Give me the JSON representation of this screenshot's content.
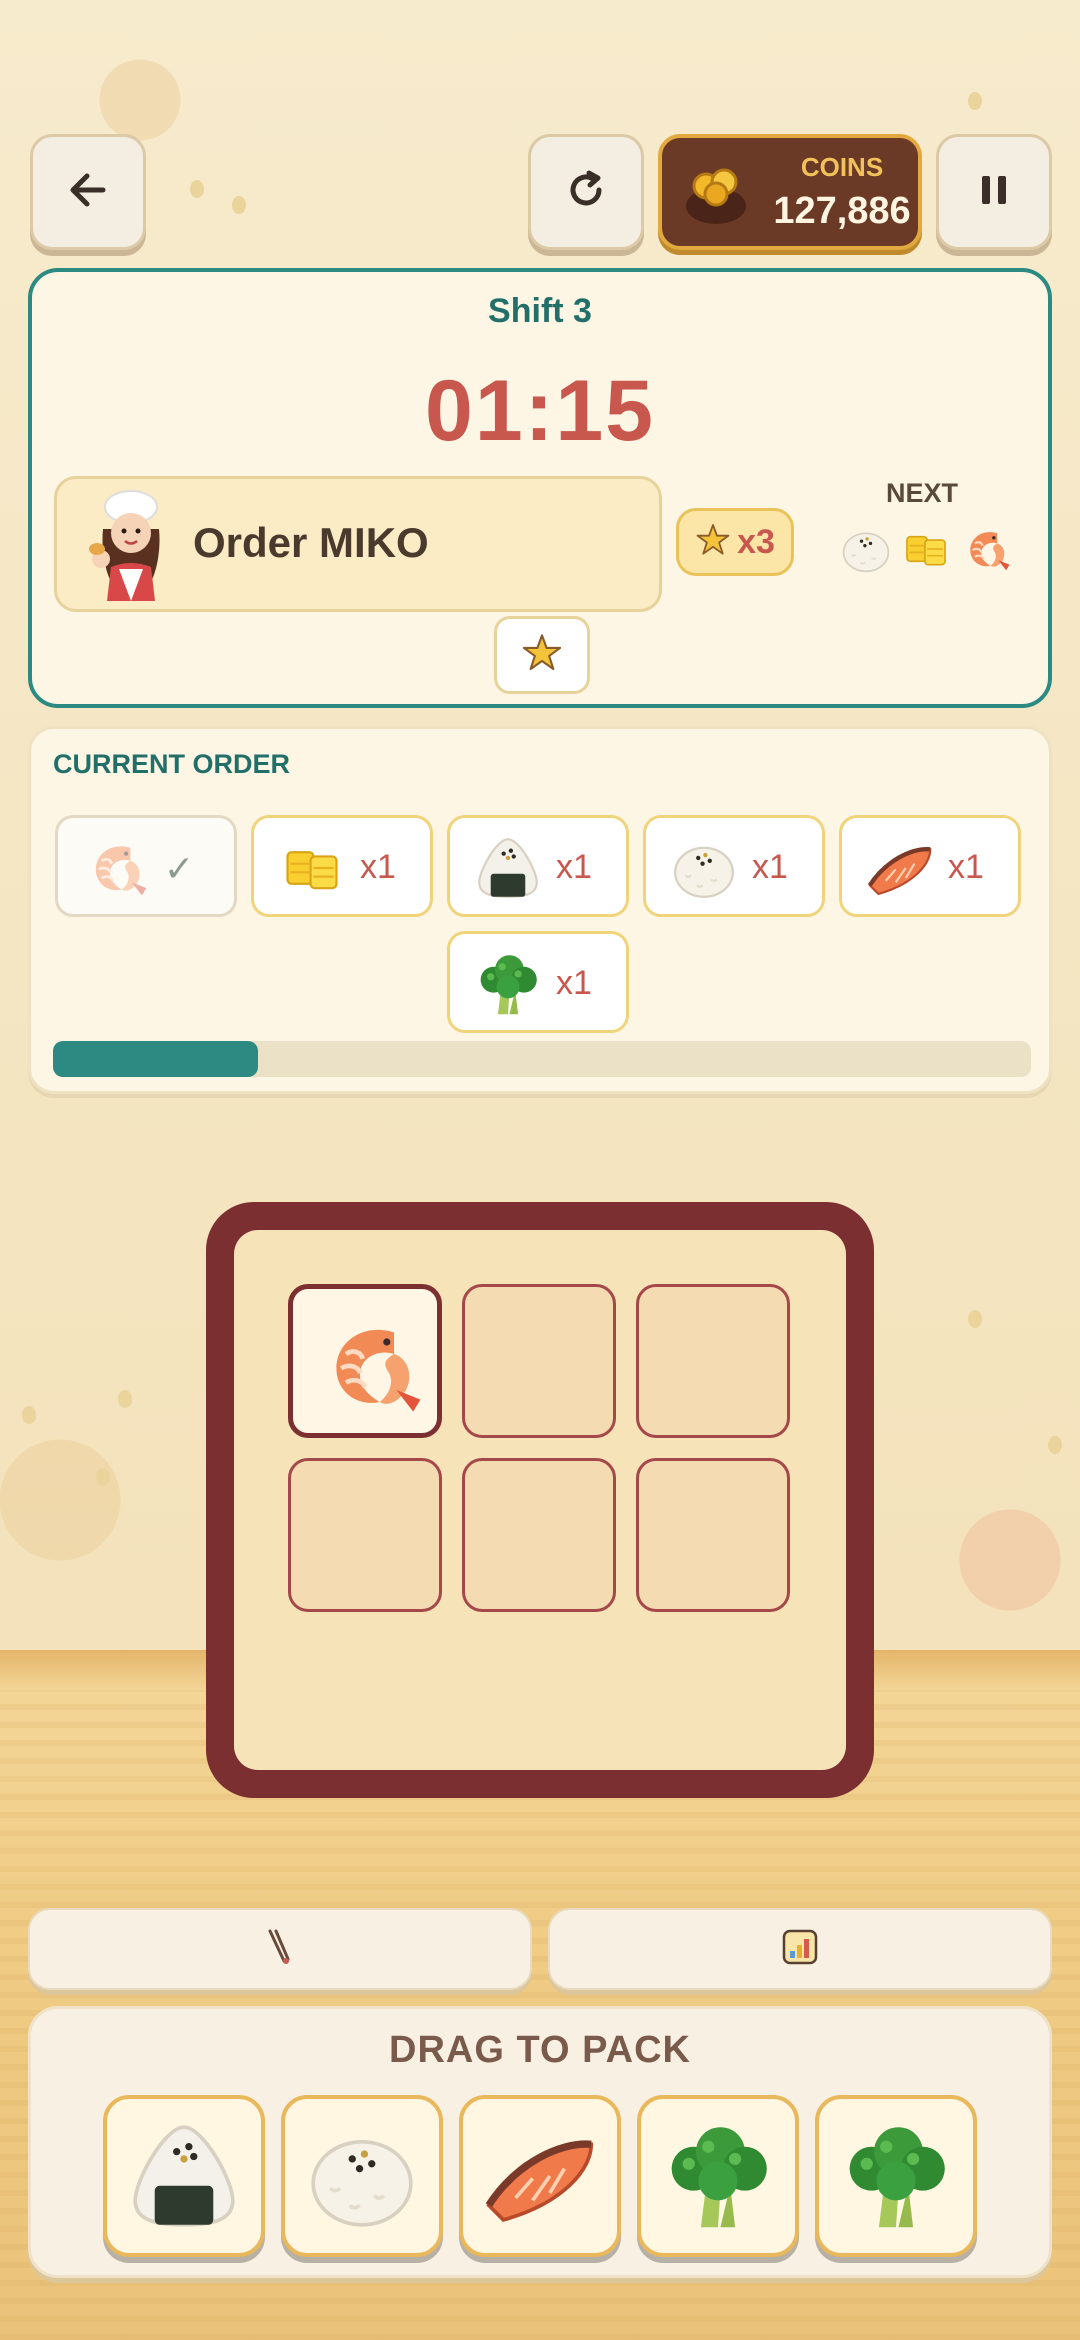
{
  "header": {
    "back_icon": "arrow-left-icon",
    "restart_icon": "restart-icon",
    "pause_icon": "pause-icon",
    "coins_label": "COINS",
    "coins_value": "127,886"
  },
  "shift": {
    "title": "Shift 3",
    "timer": "01:15",
    "order_name": "Order MIKO",
    "star_multiplier": "x3",
    "next_label": "NEXT",
    "next_items": [
      "rice-ball-icon",
      "tamagoyaki-icon",
      "shrimp-icon"
    ]
  },
  "current_order": {
    "label": "CURRENT ORDER",
    "items": [
      {
        "icon": "shrimp-icon",
        "count": "✓",
        "done": true
      },
      {
        "icon": "tamagoyaki-icon",
        "count": "x1"
      },
      {
        "icon": "onigiri-icon",
        "count": "x1"
      },
      {
        "icon": "rice-ball-icon",
        "count": "x1"
      },
      {
        "icon": "salmon-icon",
        "count": "x1"
      },
      {
        "icon": "broccoli-icon",
        "count": "x1"
      }
    ],
    "progress": 0.21
  },
  "bento": {
    "cells": [
      "shrimp-icon",
      "",
      "",
      "",
      "",
      ""
    ]
  },
  "tools": {
    "left_icon": "chopsticks-icon",
    "right_icon": "stats-icon"
  },
  "tray": {
    "title": "DRAG TO PACK",
    "items": [
      "onigiri-icon",
      "rice-ball-icon",
      "salmon-icon",
      "broccoli-icon",
      "broccoli-icon"
    ]
  },
  "colors": {
    "teal": "#2d8a83",
    "timer_red": "#c8574e",
    "bento_brown": "#7c2f31",
    "coin_gold": "#e2a93f"
  }
}
